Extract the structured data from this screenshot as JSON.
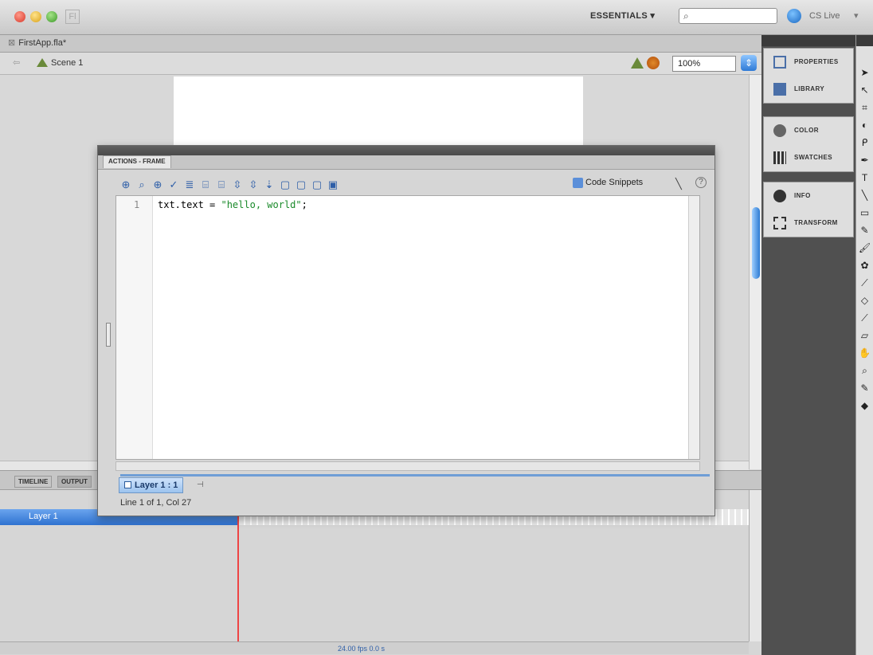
{
  "window": {
    "workspace_label": "ESSENTIALS ▾",
    "search_placeholder": "",
    "cs_live_label": "CS Live",
    "document_tab": "FirstApp.fla*"
  },
  "editbar": {
    "scene_label": "Scene 1",
    "zoom_value": "100%"
  },
  "actions_panel": {
    "tab_label": "ACTIONS - FRAME",
    "code_snippets_label": "Code Snippets",
    "line_number": "1",
    "code_prefix": "txt.text = ",
    "code_string": "\"hello, world\"",
    "code_suffix": ";",
    "layer_tab_label": "Layer 1 : 1",
    "status_text": "Line 1 of 1, Col 27"
  },
  "dock": {
    "items": [
      {
        "label": "PROPERTIES",
        "icon": "properties-icon"
      },
      {
        "label": "LIBRARY",
        "icon": "library-icon"
      },
      {
        "label": "COLOR",
        "icon": "color-icon"
      },
      {
        "label": "SWATCHES",
        "icon": "swatches-icon"
      },
      {
        "label": "INFO",
        "icon": "info-icon"
      },
      {
        "label": "TRANSFORM",
        "icon": "transform-icon"
      }
    ]
  },
  "timeline": {
    "tab_timeline": "TIMELINE",
    "tab_output": "OUTPUT",
    "layer_name": "Layer 1",
    "fps_text": "24.00 fps  0.0 s"
  },
  "colors": {
    "accent": "#2f72d0",
    "playhead": "#e44444",
    "string_literal": "#1a8a2a"
  }
}
